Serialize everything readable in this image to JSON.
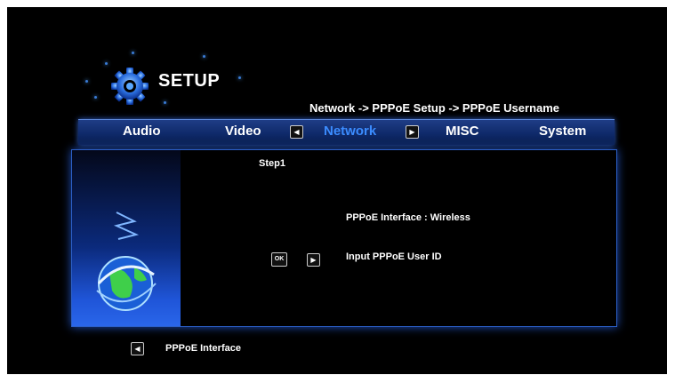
{
  "header": {
    "title": "SETUP"
  },
  "breadcrumb": "Network -> PPPoE Setup  -> PPPoE Username",
  "tabs": [
    {
      "label": "Audio"
    },
    {
      "label": "Video"
    },
    {
      "label": "Network",
      "active": true
    },
    {
      "label": "MISC"
    },
    {
      "label": "System"
    }
  ],
  "panel": {
    "step": "Step1",
    "interface_line": "PPPoE Interface : Wireless",
    "input_line": "Input PPPoE User ID",
    "ok_label": "OK"
  },
  "footer": {
    "back_label": "PPPoE Interface"
  },
  "colors": {
    "accent": "#3b8cff",
    "tab_bar": "#14347a",
    "panel_border": "#2c60c8"
  }
}
